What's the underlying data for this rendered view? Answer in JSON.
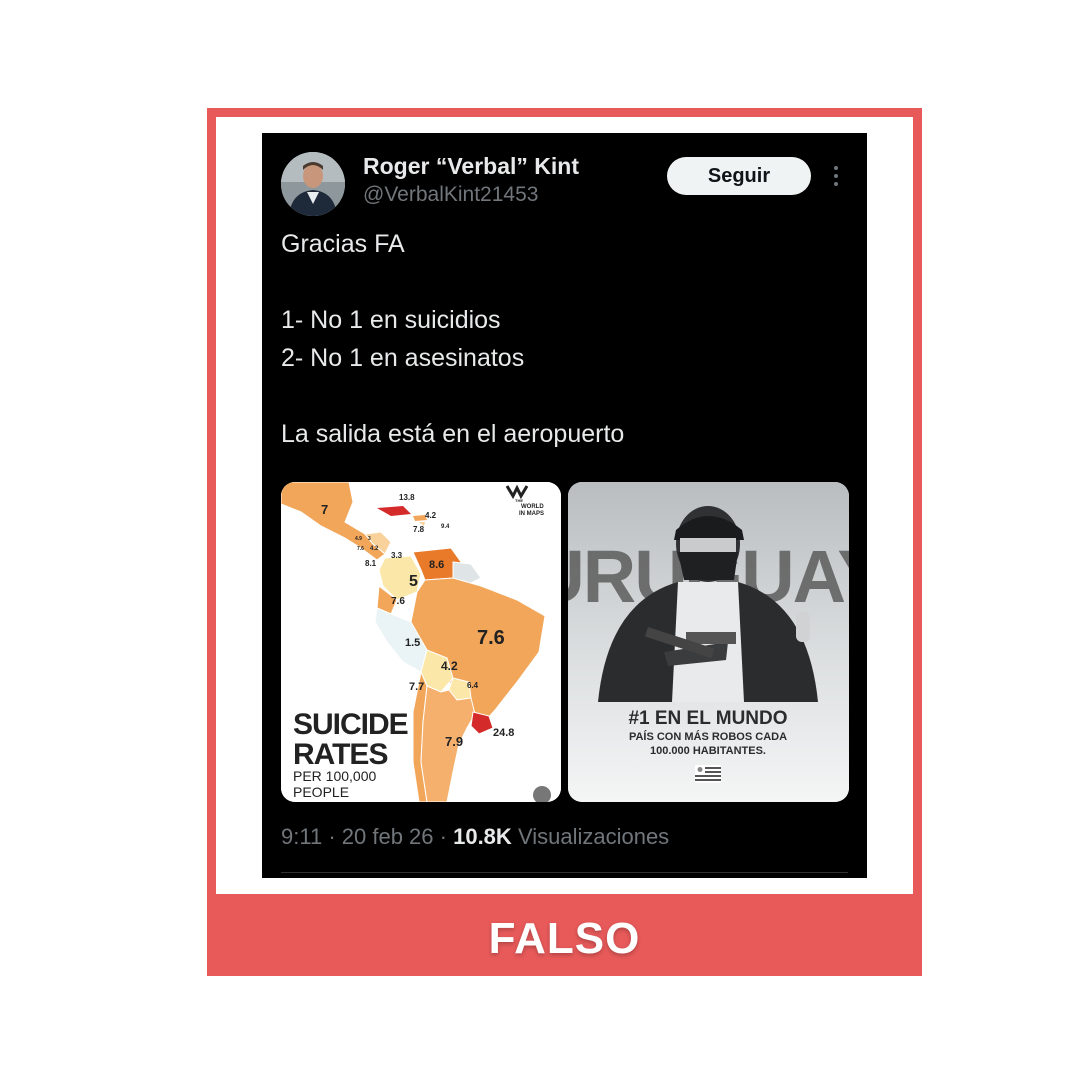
{
  "label": "FALSO",
  "tweet": {
    "author_name": "Roger “Verbal” Kint",
    "handle": "@VerbalKint21453",
    "follow_label": "Seguir",
    "lines": [
      "Gracias FA",
      "1- No 1 en suicidios",
      "2- No 1 en asesinatos",
      "La salida está en el aeropuerto"
    ],
    "time": "9:11",
    "date": "20 feb 26",
    "views": "10.8K",
    "views_label": "Visualizaciones"
  },
  "media1": {
    "logo_lines": [
      "THE",
      "WORLD",
      "IN MAPS"
    ],
    "title_line1": "SUICIDE",
    "title_line2": "RATES",
    "subtitle_line1": "PER 100,000",
    "subtitle_line2": "PEOPLE",
    "map_values": [
      "13.8",
      "7",
      "4.2",
      "7.8",
      "9.4",
      "4.9",
      "3",
      "7.6",
      "4.2",
      "3.3",
      "8.1",
      "8.6",
      "5",
      "7.6",
      "1.5",
      "7.6",
      "4.2",
      "6.4",
      "7.7",
      "24.8",
      "7.9"
    ]
  },
  "media2": {
    "banner_text": "URUGUAY",
    "headline": "#1 EN EL MUNDO",
    "sub_line1": "PAÍS CON MÁS ROBOS CADA",
    "sub_line2": "100.000 HABITANTES."
  },
  "colors": {
    "label_red": "#e85a5a",
    "tweet_bg": "#000000",
    "map_orange": "#f2a65a",
    "map_highlight": "#d42a2a"
  }
}
